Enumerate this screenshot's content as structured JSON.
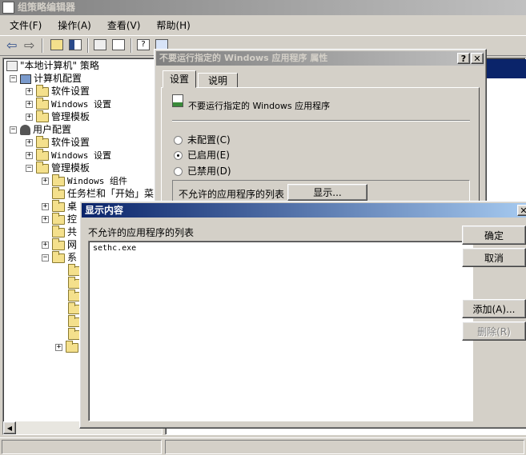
{
  "main_window": {
    "title": "组策略编辑器",
    "menu": [
      "文件(F)",
      "操作(A)",
      "查看(V)",
      "帮助(H)"
    ]
  },
  "tree": {
    "root": "\"本地计算机\" 策略",
    "computer_config": "计算机配置",
    "cc_software": "软件设置",
    "cc_windows": "Windows 设置",
    "cc_admin": "管理模板",
    "user_config": "用户配置",
    "uc_software": "软件设置",
    "uc_windows": "Windows 设置",
    "uc_admin": "管理模板",
    "windows_components": "Windows 组件",
    "taskbar": "任务栏和「开始」菜",
    "desktop": "桌",
    "control": "控",
    "shared": "共",
    "network": "网",
    "system": "系"
  },
  "props_dialog": {
    "title": "不要运行指定的 Windows 应用程序 属性",
    "tabs": [
      "设置",
      "说明"
    ],
    "policy_name": "不要运行指定的 Windows 应用程序",
    "radio_not_configured": "未配置(C)",
    "radio_enabled": "已启用(E)",
    "radio_disabled": "已禁用(D)",
    "selected": "enabled",
    "list_label": "不允许的应用程序的列表",
    "show_button": "显示..."
  },
  "show_dialog": {
    "title": "显示内容",
    "list_label": "不允许的应用程序的列表",
    "items": [
      "sethc.exe"
    ],
    "ok": "确定",
    "cancel": "取消",
    "add": "添加(A)...",
    "delete": "删除(R)"
  },
  "colors": {
    "face": "#d4d0c8",
    "active_title_start": "#0a246a",
    "active_title_end": "#a6caf0",
    "inactive_title": "#808080"
  }
}
